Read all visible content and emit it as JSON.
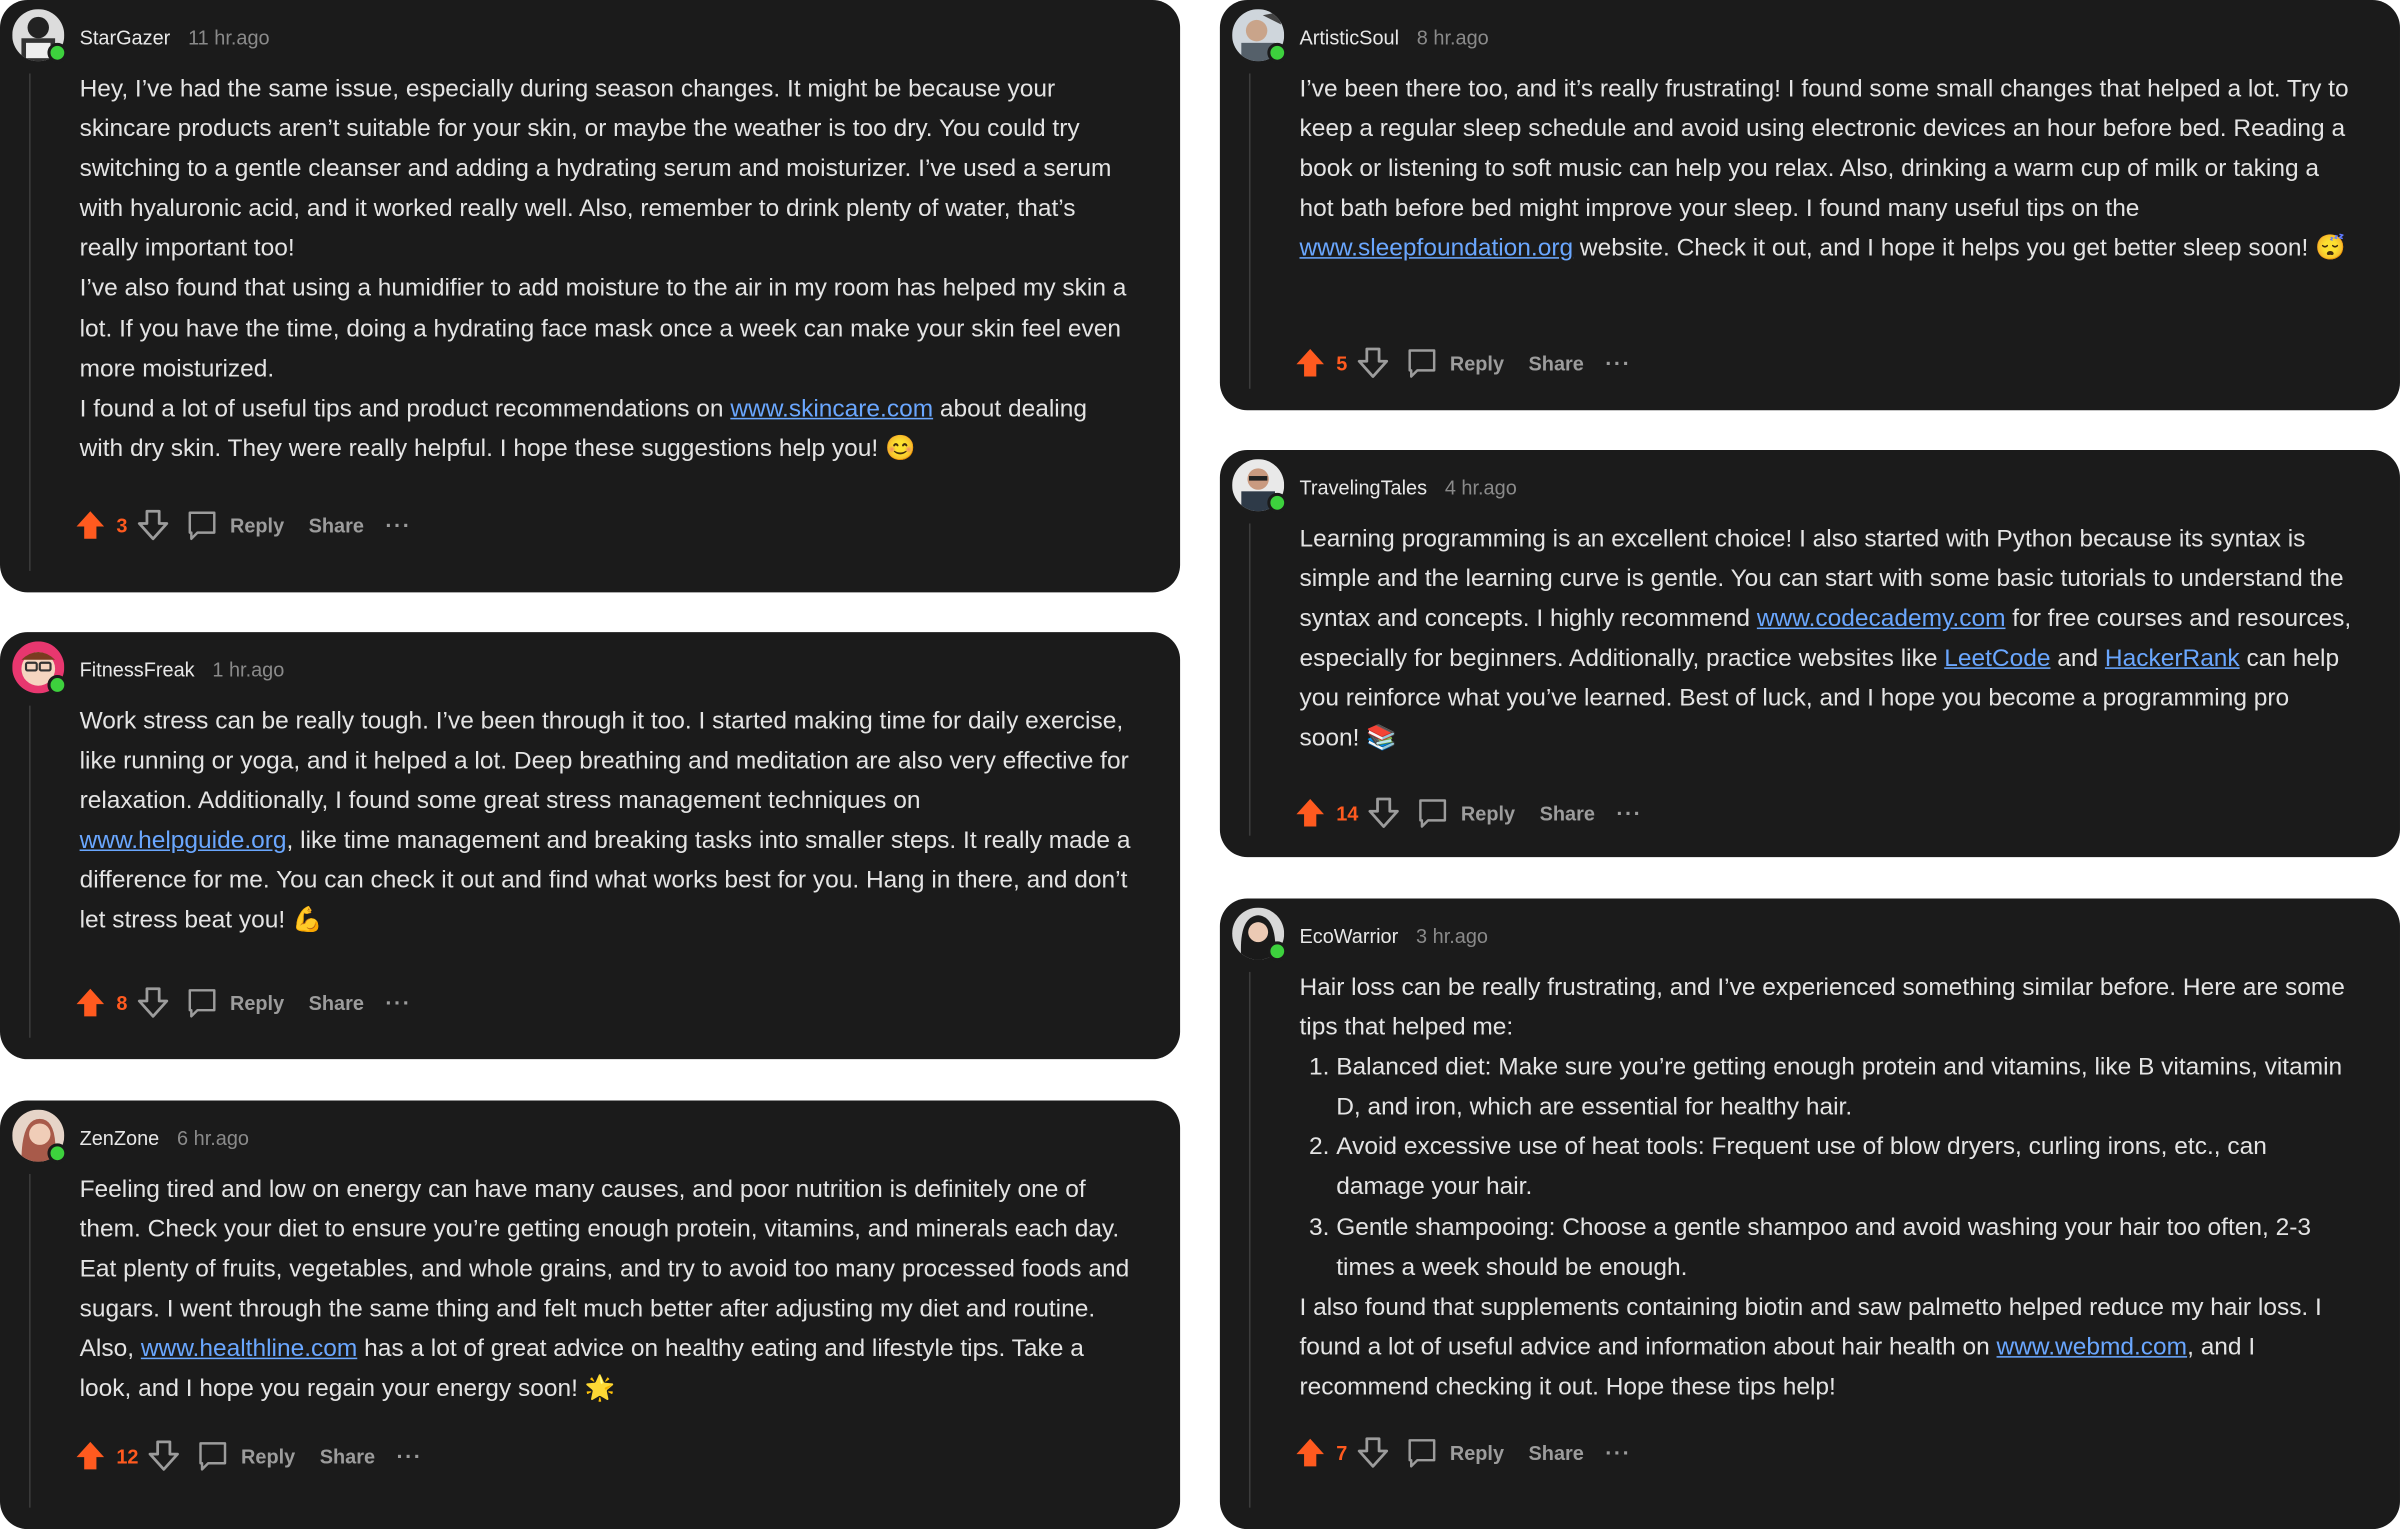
{
  "actions": {
    "reply_label": "Reply",
    "share_label": "Share",
    "more_label": "···"
  },
  "comments": [
    {
      "user": "StarGazer",
      "time": "11 hr.ago",
      "score": "3",
      "paragraphs": [
        {
          "text_before": "Hey, I’ve had the same issue, especially during season changes. It might be because your skincare products aren’t suitable for your skin, or maybe the weather is too dry. You could try switching to a gentle cleanser and adding a hydrating serum and moisturizer. I’ve used a serum with hyaluronic acid, and it worked really well. Also, remember to drink plenty of water, that’s really important too!"
        },
        {
          "text_before": "I’ve also found that using a humidifier to add moisture to the air in my room has helped my skin a lot. If you have the time, doing a hydrating face mask once a week can make your skin feel even more moisturized."
        },
        {
          "text_before": "I found a lot of useful tips and product recommendations on ",
          "link": "www.skincare.com",
          "text_after": " about dealing with dry skin. They were really helpful. I hope these suggestions help you! 😊"
        }
      ]
    },
    {
      "user": "FitnessFreak",
      "time": "1 hr.ago",
      "score": "8",
      "paragraphs": [
        {
          "text_before": "Work stress can be really tough. I’ve been through it too. I started making time for daily exercise, like running or yoga, and it helped a lot. Deep breathing and meditation are also very effective for relaxation. Additionally, I found some great stress management techniques on ",
          "link": "www.helpguide.org",
          "text_after": ", like time management and breaking tasks into smaller steps. It really made a difference for me. You can check it out and find what works best for you. Hang in there, and don’t let stress beat you! 💪"
        }
      ]
    },
    {
      "user": "ZenZone",
      "time": "6 hr.ago",
      "score": "12",
      "paragraphs": [
        {
          "text_before": "Feeling tired and low on energy can have many causes, and poor nutrition is definitely one of them. Check your diet to ensure you’re getting enough protein, vitamins, and minerals each day. Eat plenty of fruits, vegetables, and whole grains, and try to avoid too many processed foods and sugars. I went through the same thing and felt much better after adjusting my diet and routine. Also, ",
          "link": "www.healthline.com",
          "text_after": " has a lot of great advice on healthy eating and lifestyle tips. Take a look, and I hope you regain your energy soon! 🌟"
        }
      ]
    },
    {
      "user": "ArtisticSoul",
      "time": "8 hr.ago",
      "score": "5",
      "paragraphs": [
        {
          "text_before": "I’ve been there too, and it’s really frustrating! I found some small changes that helped a lot. Try to keep a regular sleep schedule and avoid using electronic devices an hour before bed. Reading a book or listening to soft music can help you relax. Also, drinking a warm cup of milk or taking a hot bath before bed might improve your sleep. I found many useful tips on the ",
          "link": "www.sleepfoundation.org",
          "text_after": " website. Check it out, and I hope it helps you get better sleep soon! 😴"
        }
      ]
    },
    {
      "user": "TravelingTales",
      "time": "4 hr.ago",
      "score": "14",
      "paragraphs": [
        {
          "text_before": "Learning programming is an excellent choice! I also started with Python because its syntax is simple and the learning curve is gentle. You can start with some basic tutorials to understand the syntax and concepts. I highly recommend ",
          "link": "www.codecademy.com",
          "text_after": " for free courses and resources, especially for beginners. Additionally, practice websites like ",
          "link2": "LeetCode",
          "text_mid": " and ",
          "link3": "HackerRank",
          "text_end": " can help you reinforce what you’ve learned. Best of luck, and I hope you become a programming pro soon! 📚"
        }
      ]
    },
    {
      "user": "EcoWarrior",
      "time": "3 hr.ago",
      "score": "7",
      "intro": "Hair loss can be really frustrating, and I’ve experienced something similar before. Here are some tips that helped me:",
      "list": [
        "Balanced diet: Make sure you’re getting enough protein and vitamins, like B vitamins, vitamin D, and iron, which are essential for healthy hair.",
        "Avoid excessive use of heat tools: Frequent use of blow dryers, curling irons, etc., can damage your hair.",
        "Gentle shampooing: Choose a gentle shampoo and avoid washing your hair too often, 2-3 times a week should be enough."
      ],
      "outro_before": "I also found that supplements containing biotin and saw palmetto helped reduce my hair loss. I found a lot of useful advice and information about hair health on ",
      "outro_link": "www.webmd.com",
      "outro_after": ", and I recommend checking it out. Hope these tips help!"
    }
  ],
  "colors": {
    "card_bg": "#1b1b1b",
    "link": "#6aa7ff",
    "upvote": "#ff5a1f",
    "online": "#3dd13d"
  }
}
